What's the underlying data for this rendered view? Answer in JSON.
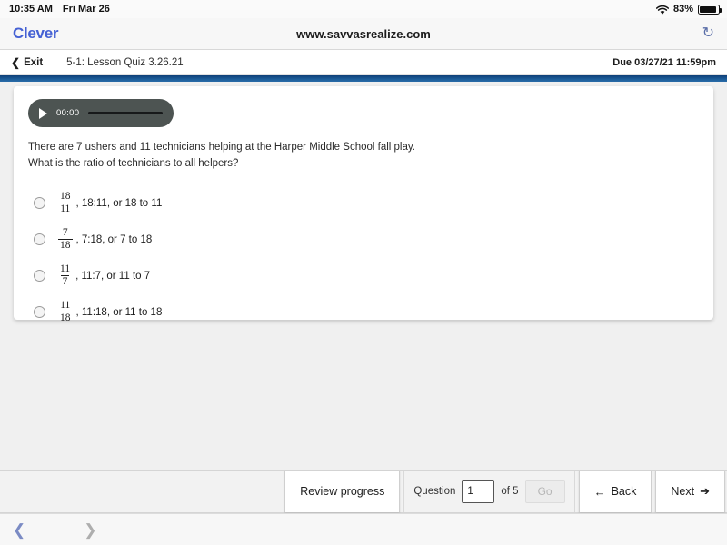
{
  "status_bar": {
    "time": "10:35 AM",
    "date": "Fri Mar 26",
    "battery_percent": "83%",
    "wifi_icon": "wifi-icon",
    "battery_icon": "battery-icon"
  },
  "browser": {
    "logo": "Clever",
    "url": "www.savvasrealize.com",
    "reload_icon": "↻",
    "back_chevron": "❮",
    "forward_chevron": "❯"
  },
  "app_toolbar": {
    "exit_chevron": "❮",
    "exit_label": "Exit",
    "quiz_title": "5-1: Lesson Quiz 3.26.21",
    "due": "Due 03/27/21 11:59pm"
  },
  "audio": {
    "play_icon": "play-icon",
    "time": "00:00"
  },
  "question": {
    "line1": "There are 7 ushers and 11 technicians helping at the Harper Middle School fall play.",
    "line2": "What is the ratio of technicians to all helpers?",
    "options": [
      {
        "numerator": "18",
        "denominator": "11",
        "text": ", 18:11, or 18 to 11",
        "selected": false
      },
      {
        "numerator": "7",
        "denominator": "18",
        "text": ", 7:18, or 7 to 18",
        "selected": false
      },
      {
        "numerator": "11",
        "denominator": "7",
        "text": ", 11:7, or 11 to 7",
        "selected": false
      },
      {
        "numerator": "11",
        "denominator": "18",
        "text": ", 11:18, or 11 to 18",
        "selected": false
      }
    ]
  },
  "bottom_bar": {
    "review_label": "Review progress",
    "question_label": "Question",
    "question_value": "1",
    "of_label": "of 5",
    "go_label": "Go",
    "back_arrow": "←",
    "back_label": "Back",
    "next_label": "Next",
    "next_arrow": "➔"
  },
  "colors": {
    "accent_blue": "#1b5b97",
    "clever_blue": "#4561d4",
    "audio_gray": "#4d5452"
  }
}
